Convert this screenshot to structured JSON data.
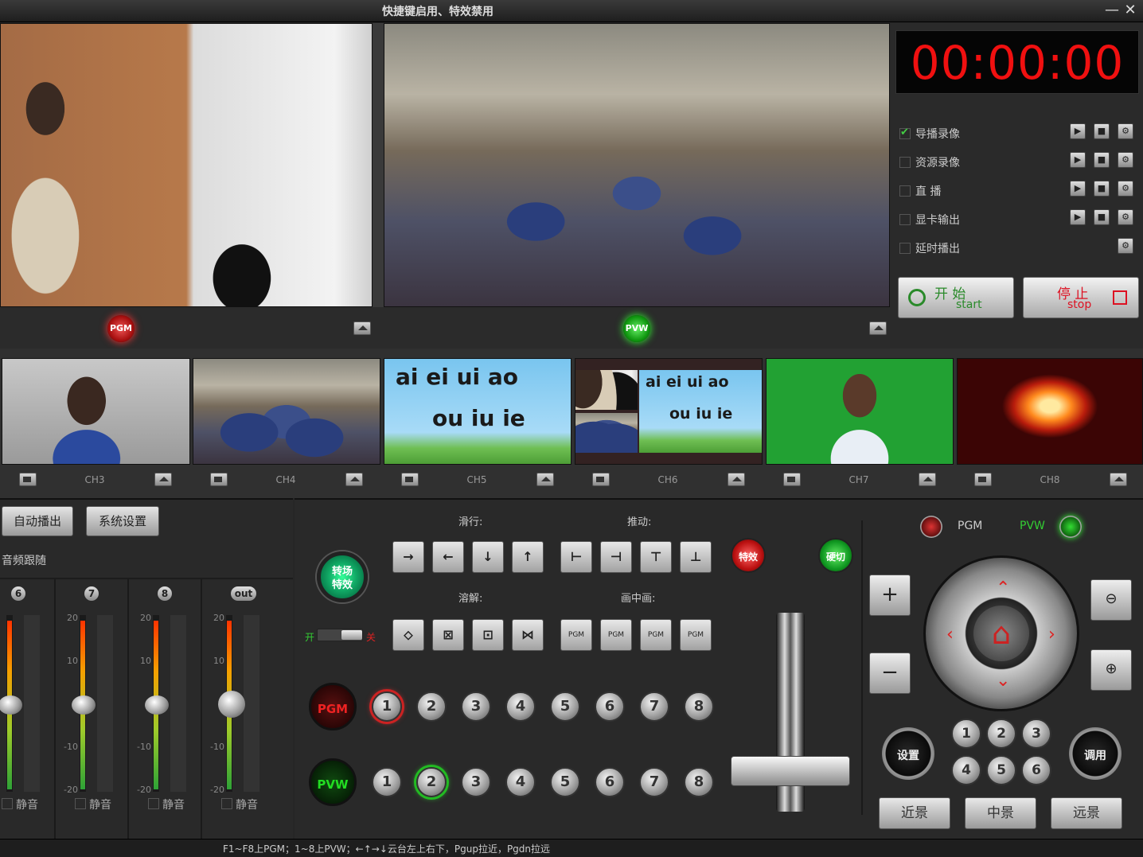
{
  "window": {
    "title": "快捷键启用、特效禁用",
    "minimize": "—",
    "close": "✕"
  },
  "pgm_label": "PGM",
  "pvw_label": "PVW",
  "timer": "00:00:00",
  "options": [
    {
      "label": "导播录像",
      "checked": true,
      "has_play": true
    },
    {
      "label": "资源录像",
      "checked": false,
      "has_play": true
    },
    {
      "label": "直 播",
      "checked": false,
      "has_play": true
    },
    {
      "label": "显卡输出",
      "checked": false,
      "has_play": true
    },
    {
      "label": "延时播出",
      "checked": false,
      "has_play": false
    }
  ],
  "start_button": {
    "cn": "开 始",
    "en": "start"
  },
  "stop_button": {
    "cn": "停 止",
    "en": "stop"
  },
  "channels": [
    "CH3",
    "CH4",
    "CH5",
    "CH6",
    "CH7",
    "CH8"
  ],
  "pinyin": {
    "line1": "ai  ei  ui  ao",
    "line2": "ou  iu  ie"
  },
  "auto_play_button": "自动播出",
  "system_settings_button": "系统设置",
  "audio_follow": "音频跟随",
  "audio_channels": [
    "6",
    "7",
    "8",
    "out"
  ],
  "fader_ticks": [
    "20",
    "10",
    "0",
    "-10",
    "-20"
  ],
  "audio_levels": [
    0.5,
    0.5,
    0.5,
    0.5
  ],
  "mute_label": "静音",
  "slide_label": "滑行:",
  "push_label": "推动:",
  "dissolve_label": "溶解:",
  "pip_label": "画中画:",
  "transition_button": {
    "line1": "转场",
    "line2": "特效"
  },
  "toggle_on": "开",
  "toggle_off": "关",
  "effect_button": "特效",
  "hard_cut_button": "硬切",
  "pip_buttons": [
    "PGM",
    "PGM",
    "PGM",
    "PGM"
  ],
  "bus_pgm": "PGM",
  "bus_pvw": "PVW",
  "bus_numbers": [
    "1",
    "2",
    "3",
    "4",
    "5",
    "6",
    "7",
    "8"
  ],
  "pgm_selected": 1,
  "pvw_selected": 2,
  "ptz": {
    "pgm": "PGM",
    "pvw": "PVW",
    "settings": "设置",
    "recall": "调用",
    "zoom_in": "+",
    "zoom_out": "−"
  },
  "presets": [
    "1",
    "2",
    "3",
    "4",
    "5",
    "6"
  ],
  "shots": [
    "近景",
    "中景",
    "远景"
  ],
  "status_bar": "F1~F8上PGM；1~8上PVW；←↑→↓云台左上右下，Pgup拉近，Pgdn拉远"
}
